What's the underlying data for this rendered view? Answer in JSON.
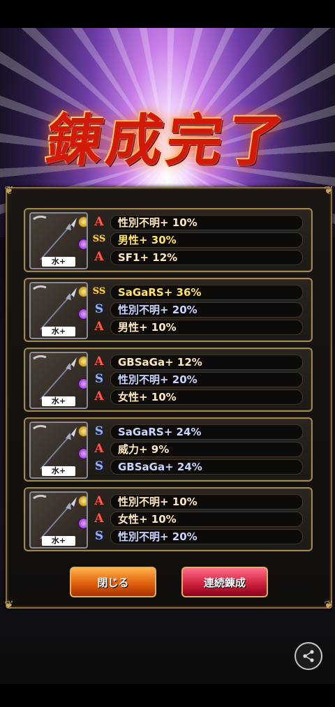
{
  "title": "錬成完了",
  "entries": [
    {
      "element_label": "水+",
      "effects": [
        {
          "rank": "A",
          "text": "性別不明+ 10%"
        },
        {
          "rank": "SS",
          "text": "男性+ 30%"
        },
        {
          "rank": "A",
          "text": "SF1+ 12%"
        }
      ]
    },
    {
      "element_label": "水+",
      "effects": [
        {
          "rank": "SS",
          "text": "SaGaRS+ 36%"
        },
        {
          "rank": "S",
          "text": "性別不明+ 20%"
        },
        {
          "rank": "A",
          "text": "男性+ 10%"
        }
      ]
    },
    {
      "element_label": "水+",
      "effects": [
        {
          "rank": "A",
          "text": "GBSaGa+ 12%"
        },
        {
          "rank": "S",
          "text": "性別不明+ 20%"
        },
        {
          "rank": "A",
          "text": "女性+ 10%"
        }
      ]
    },
    {
      "element_label": "水+",
      "effects": [
        {
          "rank": "S",
          "text": "SaGaRS+ 24%"
        },
        {
          "rank": "A",
          "text": "威力+ 9%"
        },
        {
          "rank": "S",
          "text": "GBSaGa+ 24%"
        }
      ]
    },
    {
      "element_label": "水+",
      "effects": [
        {
          "rank": "A",
          "text": "性別不明+ 10%"
        },
        {
          "rank": "A",
          "text": "女性+ 10%"
        },
        {
          "rank": "S",
          "text": "性別不明+ 20%"
        }
      ]
    }
  ],
  "rank_glyphs": {
    "A": "A",
    "S": "S",
    "SS": "SS"
  },
  "buttons": {
    "close": "閉じる",
    "continue": "連続錬成"
  },
  "icons": {
    "share": "share-icon",
    "weapon": "spear-icon"
  }
}
